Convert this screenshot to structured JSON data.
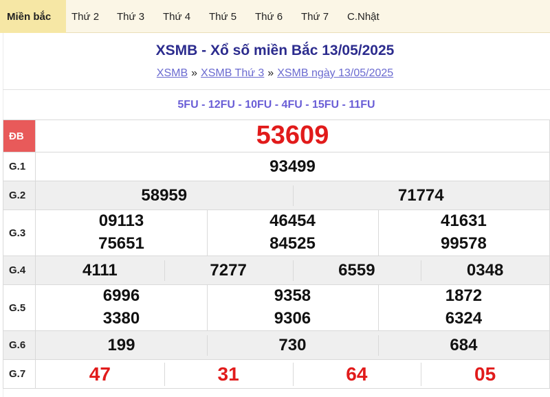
{
  "tabs": [
    "Miền bắc",
    "Thứ 2",
    "Thứ 3",
    "Thứ 4",
    "Thứ 5",
    "Thứ 6",
    "Thứ 7",
    "C.Nhật"
  ],
  "header": {
    "title": "XSMB - Xổ số miền Bắc 13/05/2025",
    "breadcrumb": [
      "XSMB",
      "XSMB Thứ 3",
      "XSMB ngày 13/05/2025"
    ],
    "separator": "»"
  },
  "codes": "5FU - 12FU - 10FU - 4FU - 15FU - 11FU",
  "prizes": {
    "db": {
      "label": "ĐB",
      "numbers": [
        "53609"
      ]
    },
    "g1": {
      "label": "G.1",
      "numbers": [
        "93499"
      ]
    },
    "g2": {
      "label": "G.2",
      "numbers": [
        "58959",
        "71774"
      ]
    },
    "g3": {
      "label": "G.3",
      "numbers": [
        "09113",
        "46454",
        "41631",
        "75651",
        "84525",
        "99578"
      ]
    },
    "g4": {
      "label": "G.4",
      "numbers": [
        "4111",
        "7277",
        "6559",
        "0348"
      ]
    },
    "g5": {
      "label": "G.5",
      "numbers": [
        "6996",
        "9358",
        "1872",
        "3380",
        "9306",
        "6324"
      ]
    },
    "g6": {
      "label": "G.6",
      "numbers": [
        "199",
        "730",
        "684"
      ]
    },
    "g7": {
      "label": "G.7",
      "numbers": [
        "47",
        "31",
        "64",
        "05"
      ]
    }
  },
  "colors": {
    "accent_red": "#e11b1b",
    "title_blue": "#2c2c8e",
    "link": "#6a6ad0",
    "tab_active": "#f6e7a5"
  }
}
